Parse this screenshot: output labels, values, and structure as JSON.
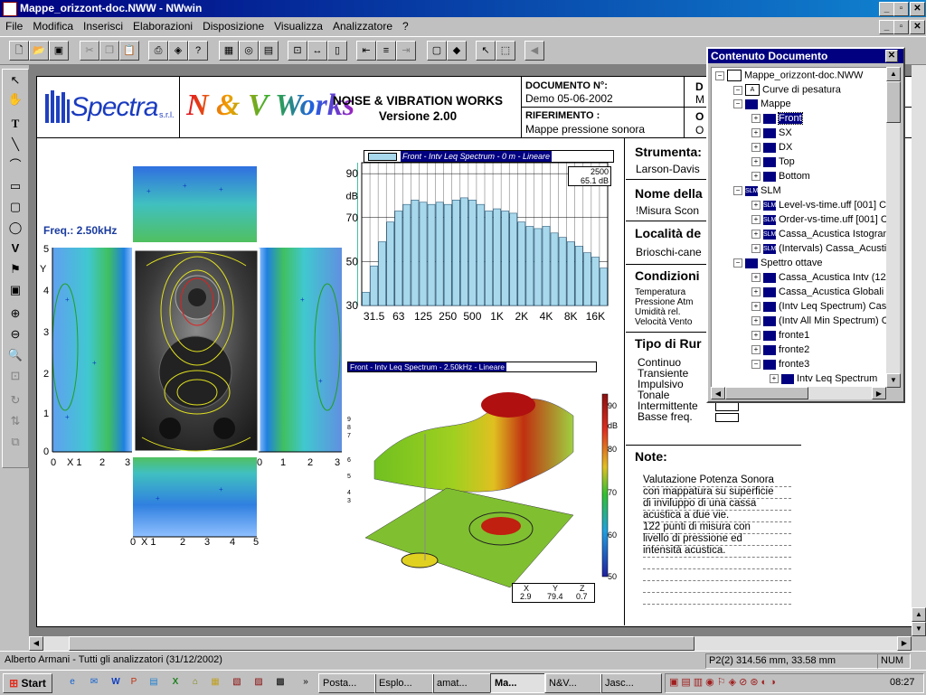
{
  "window": {
    "title": "Mappe_orizzont-doc.NWW - NWwin"
  },
  "menu": [
    "File",
    "Modifica",
    "Inserisci",
    "Elaborazioni",
    "Disposizione",
    "Visualizza",
    "Analizzatore",
    "?"
  ],
  "header": {
    "company": "Spectra",
    "company_suffix": "s.r.l.",
    "product_logo": "N & V Works",
    "product_title": "NOISE & VIBRATION WORKS",
    "product_version": "Versione  2.00",
    "doc_num_label": "DOCUMENTO N°:",
    "doc_num_value": "Demo 05-06-2002",
    "ref_label": "RIFERIMENTO :",
    "ref_value": "Mappe pressione sonora",
    "cut1": "D",
    "cut2": "M",
    "cut3": "O",
    "cut4": "O"
  },
  "right_panel": {
    "strumenta_title": "Strumenta:",
    "strumenta_value": "Larson-Davis",
    "nome_title": "Nome della",
    "nome_value": "!Misura Scon",
    "localita_title": "Località de",
    "localita_value": "Brioschi-cane",
    "condizioni_title": "Condizioni",
    "cond_rows": [
      "Temperatura",
      "Pressione Atm",
      "Umidità rel.",
      "Velocità Vento"
    ],
    "tipo_title": "Tipo di Rur",
    "tipo_rows": [
      "Continuo",
      "Transiente",
      "Impulsivo",
      "Tonale",
      "Intermittente",
      "Basse freq."
    ],
    "note_title": "Note:",
    "note_lines": [
      "Valutazione Potenza Sonora",
      "con mappatura su superficie",
      "di inviluppo di una cassa",
      "acustica a due vie.",
      "122 punti di misura con",
      "livello di pressione ed",
      "intensità acustica.",
      "",
      "",
      "",
      ""
    ]
  },
  "map": {
    "freq_label": "Freq.: 2.50kHz",
    "y_axis_label": "Y",
    "y_ticks": [
      "5",
      "4",
      "3",
      "2",
      "1",
      "0"
    ],
    "x_ticks_left": [
      "0",
      "X 1",
      "2",
      "3"
    ],
    "x_ticks_right": [
      "0",
      "1",
      "2",
      "3"
    ],
    "x_ticks_bottom": [
      "0",
      "X 1",
      "2",
      "3",
      "4",
      "5"
    ]
  },
  "spectrum": {
    "legend": "Front - Intv Leq Spectrum - 0 m - Lineare",
    "readout_freq": "2500",
    "readout_val": "65.1 dB",
    "y_unit": "dB",
    "y_ticks": [
      "90",
      "70",
      "50",
      "30"
    ],
    "x_ticks": [
      "31.5",
      "63",
      "125",
      "250",
      "500",
      "1K",
      "2K",
      "4K",
      "8K",
      "16K"
    ]
  },
  "surface": {
    "legend": "Front - Intv Leq Spectrum - 2.50kHz - Lineare",
    "scale_unit": "dB",
    "scale_ticks": [
      "90",
      "80",
      "70",
      "60",
      "50"
    ],
    "readout_labels": [
      "X",
      "Y",
      "Z"
    ],
    "readout_values": [
      "2.9",
      "79.4",
      "0.7"
    ]
  },
  "chart_data": {
    "type": "bar",
    "title": "Front - Intv Leq Spectrum - 0 m - Lineare",
    "ylabel": "dB",
    "ylim": [
      30,
      95
    ],
    "categories": [
      "25",
      "31.5",
      "40",
      "50",
      "63",
      "80",
      "100",
      "125",
      "160",
      "200",
      "250",
      "315",
      "400",
      "500",
      "630",
      "800",
      "1K",
      "1.25K",
      "1.6K",
      "2K",
      "2.5K",
      "3.15K",
      "4K",
      "5K",
      "6.3K",
      "8K",
      "10K",
      "12.5K",
      "16K",
      "20K"
    ],
    "values": [
      36,
      48,
      59,
      68,
      73,
      76,
      78,
      77,
      76,
      77,
      76,
      78,
      79,
      78,
      76,
      73,
      74,
      73,
      72,
      68,
      66,
      65,
      66,
      63,
      61,
      59,
      57,
      54,
      52,
      47
    ],
    "cursor": {
      "x": "2500",
      "y": 65.1
    }
  },
  "doc_window": {
    "title": "Contenuto Documento",
    "tree": [
      {
        "label": "Mappe_orizzont-doc.NWW",
        "level": 0,
        "icon": "doc"
      },
      {
        "label": "Curve di pesatura",
        "level": 1,
        "icon": "A"
      },
      {
        "label": "Mappe",
        "level": 1,
        "icon": "map"
      },
      {
        "label": "Front",
        "level": 2,
        "icon": "map",
        "selected": true
      },
      {
        "label": "SX",
        "level": 2,
        "icon": "map"
      },
      {
        "label": "DX",
        "level": 2,
        "icon": "map"
      },
      {
        "label": "Top",
        "level": 2,
        "icon": "map"
      },
      {
        "label": "Bottom",
        "level": 2,
        "icon": "map"
      },
      {
        "label": "SLM",
        "level": 1,
        "icon": "SLM"
      },
      {
        "label": "Level-vs-time.uff [001] Ca",
        "level": 2,
        "icon": "SLM"
      },
      {
        "label": "Order-vs-time.uff [001] Ca",
        "level": 2,
        "icon": "SLM"
      },
      {
        "label": "Cassa_Acustica Istogram",
        "level": 2,
        "icon": "SLM"
      },
      {
        "label": "(Intervals) Cassa_Acustic",
        "level": 2,
        "icon": "SLM"
      },
      {
        "label": "Spettro ottave",
        "level": 1,
        "icon": "bars"
      },
      {
        "label": "Cassa_Acustica Intv (12/",
        "level": 2,
        "icon": "bars"
      },
      {
        "label": "Cassa_Acustica Globali",
        "level": 2,
        "icon": "bars"
      },
      {
        "label": "(Intv Leq Spectrum) Cass",
        "level": 2,
        "icon": "bars"
      },
      {
        "label": "(Intv All Min Spectrum) Ca",
        "level": 2,
        "icon": "bars"
      },
      {
        "label": "fronte1",
        "level": 2,
        "icon": "bars"
      },
      {
        "label": "fronte2",
        "level": 2,
        "icon": "bars"
      },
      {
        "label": "fronte3",
        "level": 2,
        "icon": "bars"
      },
      {
        "label": "Intv Leq Spectrum",
        "level": 3,
        "icon": "house"
      }
    ]
  },
  "status": {
    "left": "Alberto Armani - Tutti gli analizzatori (31/12/2002)",
    "position": "P2(2) 314.56 mm, 33.58 mm",
    "num": "NUM"
  },
  "taskbar": {
    "start": "Start",
    "tasks": [
      "Posta...",
      "Esplo...",
      "amat...",
      "Ma...",
      "N&V...",
      "Jasc..."
    ],
    "clock": "08:27"
  }
}
